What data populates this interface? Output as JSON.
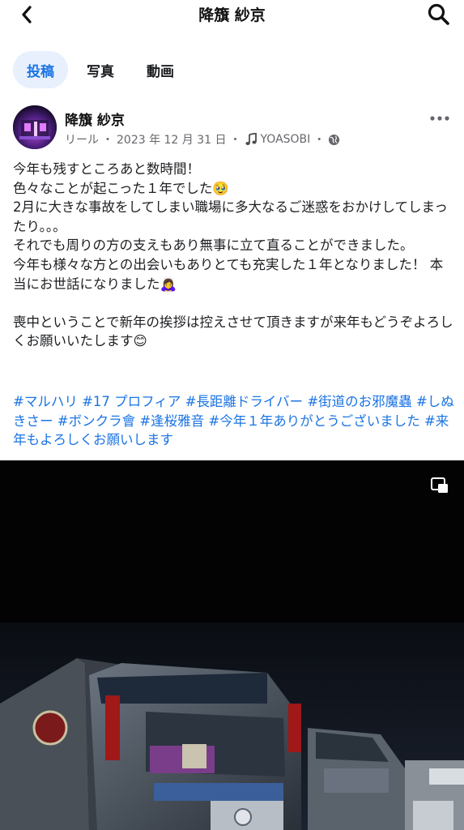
{
  "header": {
    "title": "降籏 紗京",
    "back_icon": "chevron-left-icon",
    "search_icon": "search-icon"
  },
  "tabs": [
    {
      "label": "投稿",
      "active": true
    },
    {
      "label": "写真",
      "active": false
    },
    {
      "label": "動画",
      "active": false
    }
  ],
  "post": {
    "author": "降籏 紗京",
    "type": "リール",
    "date": "2023 年 12 月 31 日",
    "sep": "・",
    "music_icon": "music-note-icon",
    "music": "YOASOBI",
    "privacy_icon": "globe-icon",
    "text_lines": [
      "今年も残すところあと数時間！",
      "色々なことが起こった１年でした🥹",
      "2月に大きな事故をしてしまい職場に多大なるご迷惑をおかけしてしまったり。。。",
      "それでも周りの方の支えもあり無事に立て直ることができました。",
      "今年も様々な方との出会いもありとても充実した１年となりました！ 本当にお世話になりました🙇‍♀️",
      "",
      "喪中ということで新年の挨拶は控えさせて頂きますが来年もどうぞよろしくお願いいたします😊"
    ],
    "hashtags": [
      "#マルハリ",
      "#17 プロフィア",
      "#長距離ドライバー",
      "#街道のお邪魔蟲",
      "#しぬきさー",
      "#ボンクラ會",
      "#逢桜雅音",
      "#今年１年ありがとうございました",
      "#来年もよろしくお願いします"
    ],
    "media": {
      "pip_icon": "picture-in-picture-icon"
    }
  }
}
